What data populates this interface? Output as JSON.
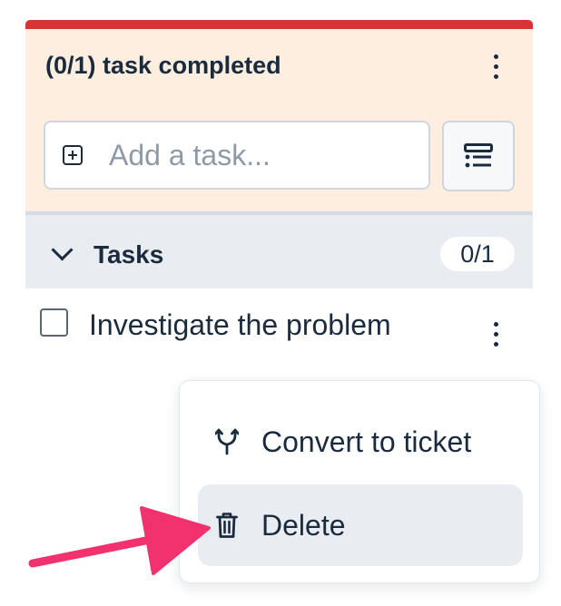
{
  "header": {
    "title": "(0/1) task completed",
    "accent_color": "#d73434",
    "background_color": "#fdeedf"
  },
  "add_task": {
    "placeholder": "Add a task..."
  },
  "tasks_section": {
    "label": "Tasks",
    "count": "0/1",
    "expanded": true
  },
  "tasks": [
    {
      "title": "Investigate the problem",
      "completed": false
    }
  ],
  "context_menu": {
    "items": [
      {
        "label": "Convert to ticket",
        "icon": "fork-icon"
      },
      {
        "label": "Delete",
        "icon": "trash-icon",
        "highlighted": true
      }
    ]
  },
  "annotation": {
    "arrow_color": "#f2316f"
  }
}
